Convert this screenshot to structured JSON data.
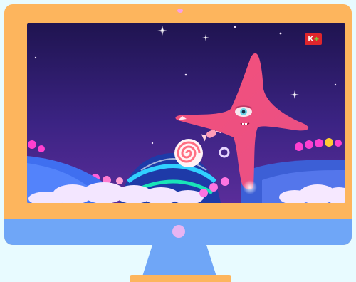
{
  "colors": {
    "background": "#e8fbff",
    "monitor_frame": "#fdb55d",
    "monitor_chin": "#6fa6f7",
    "stand": "#6fa6f7",
    "screen_sky": "#2e1a66",
    "starfish": "#f0577e",
    "channel_logo": "#e0262c"
  },
  "screen": {
    "channel_logo_text": "K",
    "channel_logo_symbol": "+"
  },
  "icons": {
    "camera": "camera-dot-icon",
    "power": "power-button-icon",
    "logo": "channel-logo-icon"
  }
}
